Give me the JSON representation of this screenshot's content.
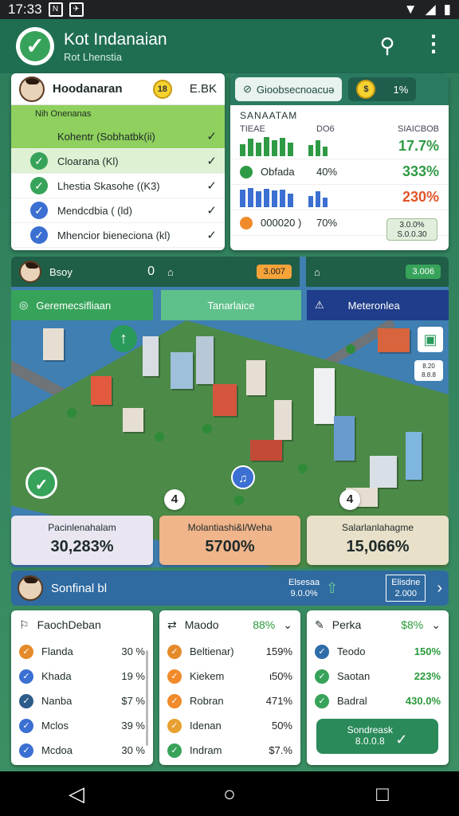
{
  "status": {
    "time": "17:33",
    "battery": "▮"
  },
  "appbar": {
    "title": "Kot Indanaian",
    "subtitle": "Rot Lhenstia"
  },
  "tasks": {
    "username": "Hoodanaran",
    "coins": "18",
    "score": "E.BK",
    "section": "Nih Onenanas",
    "items": [
      {
        "label": "Kohentr (Sobhatbk(ii)",
        "color": "#8fd05e",
        "icon": "list-icon"
      },
      {
        "label": "Cloarana (Kl)",
        "color": "#37a35a",
        "icon": "check-icon"
      },
      {
        "label": "Lhestia Skasohe ((K3)",
        "color": "#37a35a",
        "icon": "check-icon"
      },
      {
        "label": "Mendcdbia ( (ld)",
        "color": "#3b6fd1",
        "icon": "check-icon"
      },
      {
        "label": "Mhencior bieneciona (kl)",
        "color": "#3b6fd1",
        "icon": "check-icon"
      }
    ]
  },
  "stats": {
    "tab1": "Gioobsecnoacuə",
    "tab2": "1%",
    "title": "SANAATAM",
    "col1": "TIEAE",
    "col2": "DO6",
    "col3": "SIAICBOB",
    "rows": [
      {
        "label": "",
        "sub": "",
        "value": "17.7%",
        "color": "#2f9a44",
        "bars": [
          0.6,
          0.9,
          0.7,
          1.0,
          0.8,
          0.95,
          0.7
        ]
      },
      {
        "label": "Obfada",
        "sub": "40%",
        "value": "333%",
        "color": "#2f9a44",
        "bars": []
      },
      {
        "label": "",
        "sub": "",
        "value": "230%",
        "color": "#e0562a",
        "bars": [
          0.9,
          1.0,
          0.8,
          0.95,
          0.85,
          0.9,
          0.7
        ]
      },
      {
        "label": "000020 )",
        "sub": "70%",
        "value": "3.0.0%",
        "color": "#333",
        "bars": []
      }
    ],
    "badge": "3.0.0%\nS.0.0.30"
  },
  "map": {
    "player": "Bsoy",
    "player_count": "0",
    "badge1": "3.007",
    "badge2": "3.006",
    "btn1": "Geremecsifliaan",
    "btn2": "Tanarlaice",
    "btn3": "Meteronlea",
    "bubble1": "4",
    "bubble2": "4",
    "side_info": "8.20\n8.8.8"
  },
  "tiles": [
    {
      "label": "Pacinlenahalam",
      "value": "30,283%",
      "bg": "#e9e6f2"
    },
    {
      "label": "Molantiashi&l/Weha",
      "value": "5700%",
      "bg": "#f0b58b"
    },
    {
      "label": "Salarlanlahagme",
      "value": "15,066%",
      "bg": "#e8e0c8"
    }
  ],
  "summary": {
    "label": "Sonfinal bl",
    "mid_title": "Elsesaa",
    "mid_value": "9.0.0%",
    "right_title": "Elisdne",
    "right_value": "2.000"
  },
  "list1": {
    "title": "FaochDeban",
    "items": [
      {
        "label": "Flanda",
        "value": "30 %",
        "color": "#e58a2a"
      },
      {
        "label": "Khada",
        "value": "19 %",
        "color": "#3b6fd1"
      },
      {
        "label": "Nanba",
        "value": "$7 %",
        "color": "#2e5c8a"
      },
      {
        "label": "Mclos",
        "value": "39 %",
        "color": "#3b6fd1"
      },
      {
        "label": "Mcdoa",
        "value": "30 %",
        "color": "#3b6fd1"
      }
    ]
  },
  "list2": {
    "title": "Maodo",
    "title_value": "88%",
    "items": [
      {
        "label": "Beltienar)",
        "value": "159%",
        "color": "#e58a2a"
      },
      {
        "label": "Kiekem",
        "value": "ι50%",
        "color": "#f08a2a"
      },
      {
        "label": "Robran",
        "value": "471%",
        "color": "#f08a2a"
      },
      {
        "label": "Idenan",
        "value": "50%",
        "color": "#e8a030"
      },
      {
        "label": "Indram",
        "value": "$7.%",
        "color": "#37a35a"
      }
    ]
  },
  "list3": {
    "title": "Perka",
    "title_value": "$8%",
    "items": [
      {
        "label": "Teodo",
        "value": "150%",
        "color": "#2e6da8"
      },
      {
        "label": "Saotan",
        "value": "223%",
        "color": "#37a35a"
      },
      {
        "label": "Badral",
        "value": "430.0%",
        "color": "#37a35a"
      }
    ],
    "button": "Sondreask\n8.0.0.8"
  }
}
